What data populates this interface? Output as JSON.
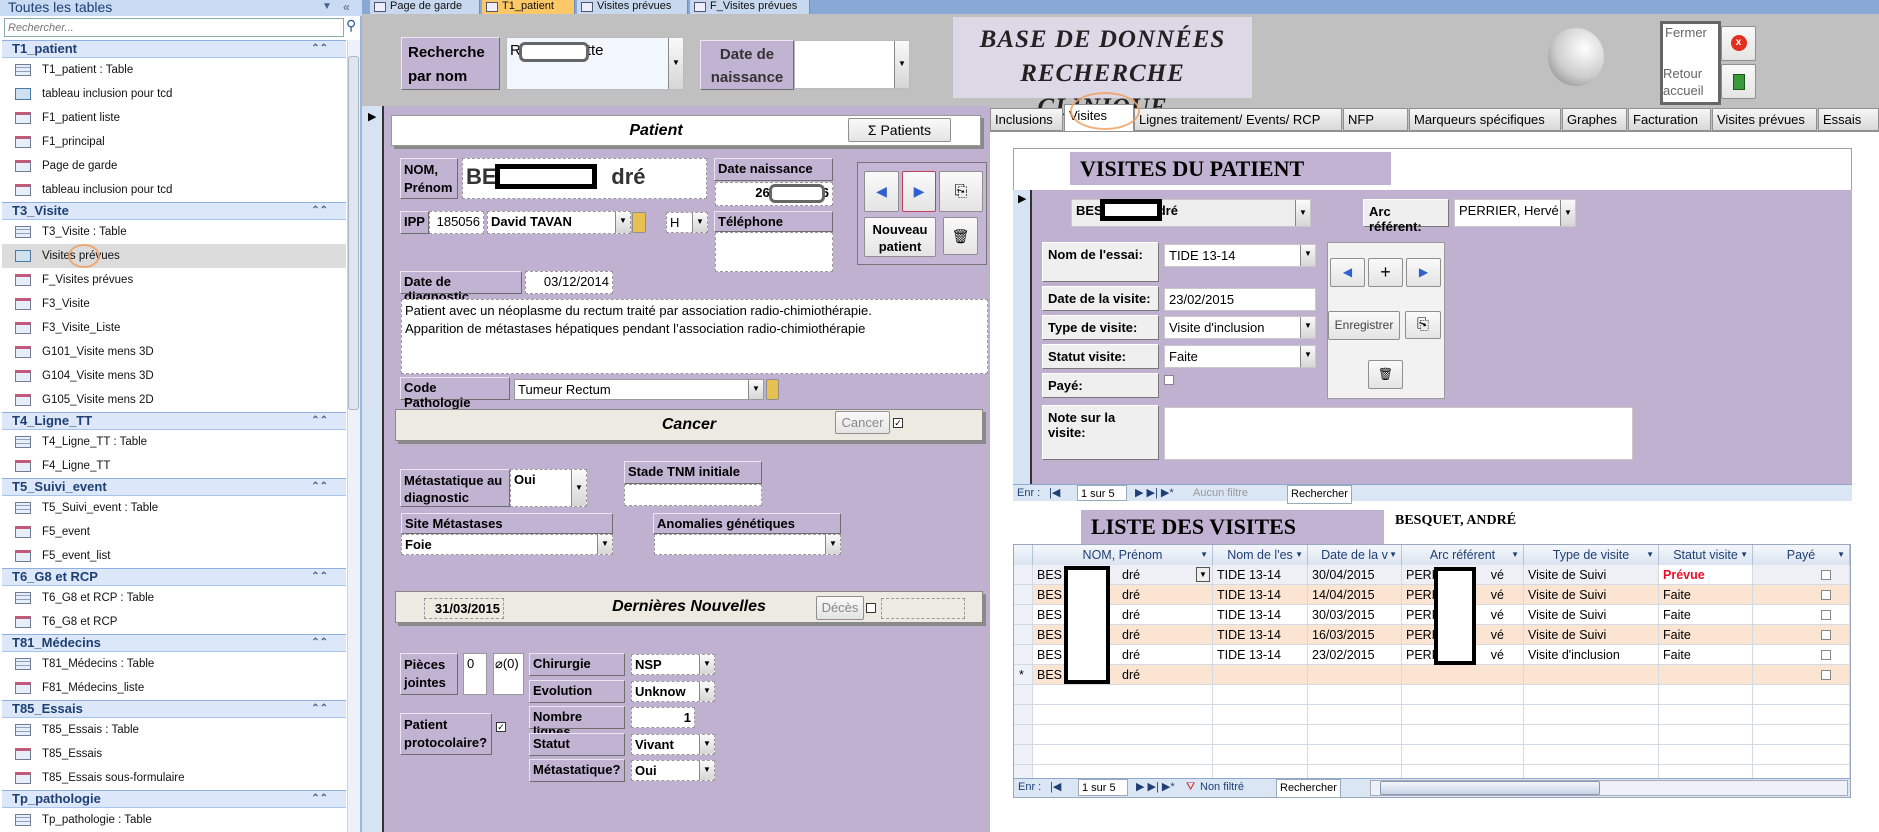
{
  "sidebar": {
    "title": "Toutes les tables",
    "search_placeholder": "Rechercher...",
    "groups": [
      {
        "name": "T1_patient",
        "items": [
          {
            "label": "T1_patient : Table",
            "icon": "table"
          },
          {
            "label": "tableau inclusion pour tcd",
            "icon": "query"
          },
          {
            "label": "F1_patient liste",
            "icon": "form"
          },
          {
            "label": "F1_principal",
            "icon": "form"
          },
          {
            "label": "Page de garde",
            "icon": "form"
          },
          {
            "label": "tableau inclusion pour tcd",
            "icon": "form"
          }
        ]
      },
      {
        "name": "T3_Visite",
        "items": [
          {
            "label": "T3_Visite : Table",
            "icon": "table"
          },
          {
            "label": "Visites prévues",
            "icon": "query",
            "selected": true
          },
          {
            "label": "F_Visites prévues",
            "icon": "form"
          },
          {
            "label": "F3_Visite",
            "icon": "form",
            "highlighted": true
          },
          {
            "label": "F3_Visite_Liste",
            "icon": "form"
          },
          {
            "label": "G101_Visite mens 3D",
            "icon": "form"
          },
          {
            "label": "G104_Visite mens 3D",
            "icon": "form"
          },
          {
            "label": "G105_Visite mens 2D",
            "icon": "form"
          }
        ]
      },
      {
        "name": "T4_Ligne_TT",
        "items": [
          {
            "label": "T4_Ligne_TT : Table",
            "icon": "table"
          },
          {
            "label": "F4_Ligne_TT",
            "icon": "form"
          }
        ]
      },
      {
        "name": "T5_Suivi_event",
        "items": [
          {
            "label": "T5_Suivi_event : Table",
            "icon": "table"
          },
          {
            "label": "F5_event",
            "icon": "form"
          },
          {
            "label": "F5_event_list",
            "icon": "form"
          }
        ]
      },
      {
        "name": "T6_G8 et RCP",
        "items": [
          {
            "label": "T6_G8 et RCP : Table",
            "icon": "table"
          },
          {
            "label": "T6_G8 et RCP",
            "icon": "form"
          }
        ]
      },
      {
        "name": "T81_Médecins",
        "items": [
          {
            "label": "T81_Médecins : Table",
            "icon": "table"
          },
          {
            "label": "F81_Médecins_liste",
            "icon": "form"
          }
        ]
      },
      {
        "name": "T85_Essais",
        "items": [
          {
            "label": "T85_Essais : Table",
            "icon": "table"
          },
          {
            "label": "T85_Essais",
            "icon": "form"
          },
          {
            "label": "T85_Essais sous-formulaire",
            "icon": "form"
          }
        ]
      },
      {
        "name": "Tp_pathologie",
        "items": [
          {
            "label": "Tp_pathologie : Table",
            "icon": "table"
          }
        ]
      }
    ]
  },
  "doc_tabs": [
    {
      "label": "Page de garde"
    },
    {
      "label": "T1_patient",
      "active": true
    },
    {
      "label": "Visites prévues"
    },
    {
      "label": "F_Visites prévues"
    }
  ],
  "header": {
    "search_label": "Recherche par nom",
    "search_value_start": "R",
    "search_value_end": "tte",
    "dob_label": "Date de naissance",
    "dob_value": "",
    "title_line1": "BASE DE DONNÉES",
    "title_line2": "RECHERCHE CLINIQUE",
    "close_label": "Fermer",
    "home_label": "Retour accueil"
  },
  "patient": {
    "section_title": "Patient",
    "patients_button": "Σ Patients",
    "name_label": "NOM, Prénom",
    "name_start": "BES",
    "name_end": "dré",
    "dob_label": "Date naissance",
    "dob_start": "26",
    "dob_end": "6",
    "ipp_label": "IPP",
    "ipp_value": "185056",
    "doctor": "David TAVAN",
    "sex": "H",
    "phone_label": "Téléphone",
    "phone_value": "",
    "new_patient_button": "Nouveau patient",
    "diag_date_label": "Date de diagnostic",
    "diag_date": "03/12/2014",
    "notes_line1": "Patient avec un néoplasme du rectum traité par association radio-chimiothérapie.",
    "notes_line2": "Apparition de métastases hépatiques pendant l’association radio-chimiothérapie",
    "patho_label": "Code Pathologie",
    "patho_value": "Tumeur Rectum"
  },
  "cancer": {
    "section_title": "Cancer",
    "button": "Cancer",
    "checked": true,
    "meta_diag_label": "Métastatique au diagnostic",
    "meta_diag_value": "Oui",
    "tnm_label": "Stade TNM initiale",
    "tnm_value": "",
    "site_label": "Site Métastases",
    "site_value": "Foie",
    "anomalies_label": "Anomalies génétiques",
    "anomalies_value": ""
  },
  "news": {
    "section_title": "Dernières Nouvelles",
    "date": "31/03/2015",
    "death_button": "Décès",
    "death_checked": false,
    "death_date": "",
    "attachments_label": "Pièces jointes",
    "attachments_count": "0",
    "attachments_clip": "(0)",
    "protocol_label": "Patient protocolaire?",
    "protocol_checked": true,
    "fields": [
      {
        "label": "Chirurgie",
        "value": "NSP",
        "combo": true
      },
      {
        "label": "Evolution",
        "value": "Unknow",
        "combo": true
      },
      {
        "label": "Nombre lignes",
        "value": "1",
        "combo": false
      },
      {
        "label": "Statut",
        "value": "Vivant",
        "combo": true
      },
      {
        "label": "Métastatique?",
        "value": "Oui",
        "combo": true
      }
    ]
  },
  "right_tabs": [
    {
      "label": "Inclusions"
    },
    {
      "label": "Visites",
      "active": true
    },
    {
      "label": "Lignes traitement/ Events/ RCP"
    },
    {
      "label": "NFP"
    },
    {
      "label": "Marqueurs spécifiques"
    },
    {
      "label": "Graphes"
    },
    {
      "label": "Facturation"
    },
    {
      "label": "Visites prévues"
    },
    {
      "label": "Essais"
    }
  ],
  "visit_form": {
    "title": "VISITES DU PATIENT",
    "patient_start": "BES",
    "patient_end": "dré",
    "arc_label": "Arc référent:",
    "arc_value": "PERRIER, Hervé",
    "trial_label": "Nom de l'essai:",
    "trial_value": "TIDE 13-14",
    "date_label": "Date de la visite:",
    "date_value": "23/02/2015",
    "type_label": "Type de visite:",
    "type_value": "Visite d'inclusion",
    "status_label": "Statut visite:",
    "status_value": "Faite",
    "paid_label": "Payé:",
    "paid": false,
    "note_label": "Note sur la visite:",
    "note_value": "",
    "add_button": "+",
    "save_button": "Enregistrer",
    "nav": {
      "prefix": "Enr :",
      "position": "1 sur 5",
      "filter": "Aucun filtre",
      "search": "Rechercher"
    }
  },
  "visit_list": {
    "title": "LISTE DES VISITES",
    "patient": "BESQUET, ANDRÉ",
    "columns": [
      "NOM, Prénom",
      "Nom de l'es",
      "Date de la v",
      "Arc référent",
      "Type de visite",
      "Statut visite",
      "Payé"
    ],
    "rows": [
      {
        "name_start": "BES",
        "name_end": "dré",
        "trial": "TIDE 13-14",
        "date": "30/04/2015",
        "arc_start": "PERR",
        "arc_end": "vé",
        "type": "Visite de Suivi",
        "status": "Prévue",
        "paid": false
      },
      {
        "name_start": "BES",
        "name_end": "dré",
        "trial": "TIDE 13-14",
        "date": "14/04/2015",
        "arc_start": "PERR",
        "arc_end": "vé",
        "type": "Visite de Suivi",
        "status": "Faite",
        "paid": false
      },
      {
        "name_start": "BES",
        "name_end": "dré",
        "trial": "TIDE 13-14",
        "date": "30/03/2015",
        "arc_start": "PERR",
        "arc_end": "vé",
        "type": "Visite de Suivi",
        "status": "Faite",
        "paid": false
      },
      {
        "name_start": "BES",
        "name_end": "dré",
        "trial": "TIDE 13-14",
        "date": "16/03/2015",
        "arc_start": "PERR",
        "arc_end": "vé",
        "type": "Visite de Suivi",
        "status": "Faite",
        "paid": false
      },
      {
        "name_start": "BES",
        "name_end": "dré",
        "trial": "TIDE 13-14",
        "date": "23/02/2015",
        "arc_start": "PERR",
        "arc_end": "vé",
        "type": "Visite d'inclusion",
        "status": "Faite",
        "paid": false
      }
    ],
    "new_row": {
      "marker": "*",
      "name_start": "BES",
      "name_end": "dré"
    },
    "nav": {
      "prefix": "Enr :",
      "position": "1 sur 5",
      "filter": "Non filtré",
      "search": "Rechercher"
    }
  },
  "colors": {
    "form_purple": "#bfb1cf",
    "planned_status": "#e8102a",
    "alt_row": "#fbe5d2",
    "active_doc_tab": "#fbc867",
    "highlight_circle": "#f0a060"
  }
}
